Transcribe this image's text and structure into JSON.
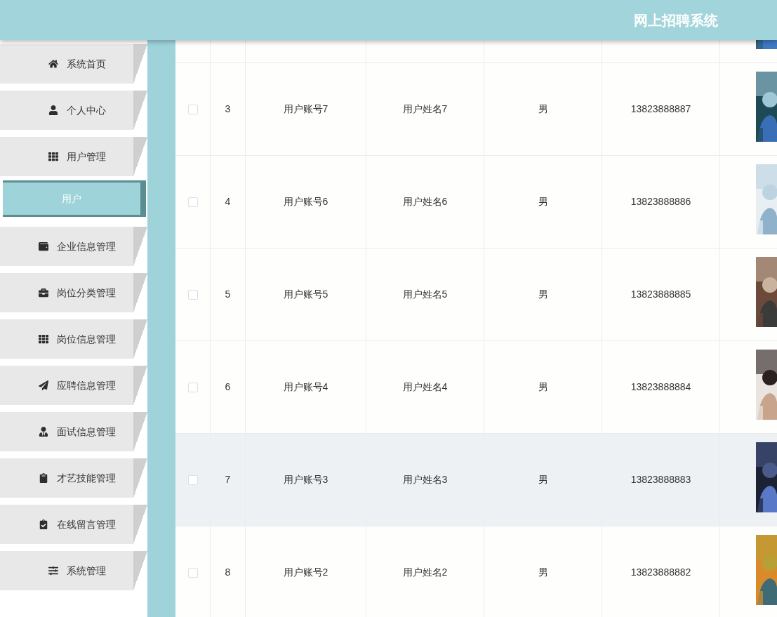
{
  "header": {
    "title": "网上招聘系统"
  },
  "sidebar": {
    "items": [
      {
        "label": "系统首页",
        "selected": false
      },
      {
        "label": "个人中心",
        "selected": false
      },
      {
        "label": "用户管理",
        "selected": false,
        "children": [
          {
            "label": "用户",
            "selected": true
          }
        ]
      },
      {
        "label": "企业信息管理",
        "selected": false
      },
      {
        "label": "岗位分类管理",
        "selected": false
      },
      {
        "label": "岗位信息管理",
        "selected": false
      },
      {
        "label": "应聘信息管理",
        "selected": false
      },
      {
        "label": "面试信息管理",
        "selected": false
      },
      {
        "label": "才艺技能管理",
        "selected": false
      },
      {
        "label": "在线留言管理",
        "selected": false
      },
      {
        "label": "系统管理",
        "selected": false
      }
    ]
  },
  "table": {
    "rows": [
      {
        "kind": "cut-off",
        "highlighted": false
      },
      {
        "kind": "row",
        "checked": false,
        "index": "3",
        "account": "用户账号7",
        "name": "用户姓名7",
        "sex": "男",
        "phone": "13823888887",
        "highlighted": false
      },
      {
        "kind": "row",
        "checked": false,
        "index": "4",
        "account": "用户账号6",
        "name": "用户姓名6",
        "sex": "男",
        "phone": "13823888886",
        "highlighted": false
      },
      {
        "kind": "row",
        "checked": false,
        "index": "5",
        "account": "用户账号5",
        "name": "用户姓名5",
        "sex": "男",
        "phone": "13823888885",
        "highlighted": false
      },
      {
        "kind": "row",
        "checked": false,
        "index": "6",
        "account": "用户账号4",
        "name": "用户姓名4",
        "sex": "男",
        "phone": "13823888884",
        "highlighted": false
      },
      {
        "kind": "row",
        "checked": false,
        "index": "7",
        "account": "用户账号3",
        "name": "用户姓名3",
        "sex": "男",
        "phone": "13823888883",
        "highlighted": true
      },
      {
        "kind": "row",
        "checked": false,
        "index": "8",
        "account": "用户账号2",
        "name": "用户姓名2",
        "sex": "男",
        "phone": "13823888882",
        "highlighted": false
      }
    ]
  }
}
